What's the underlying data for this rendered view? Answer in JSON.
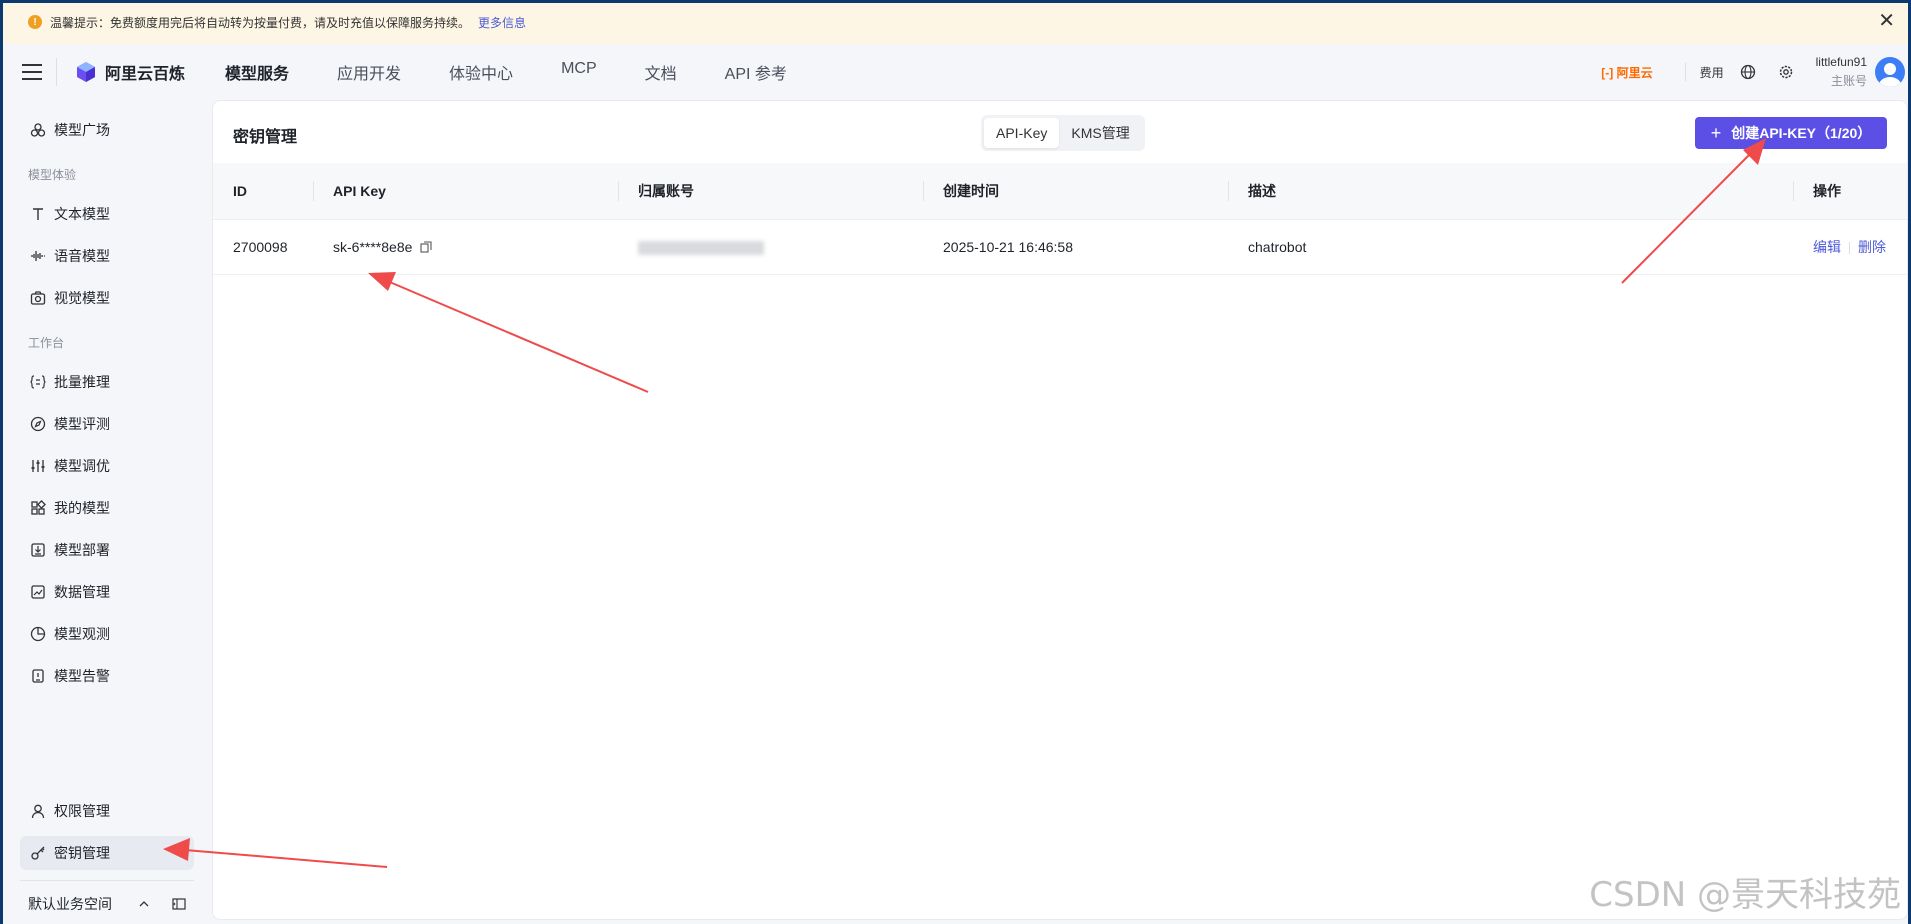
{
  "notice": {
    "text": "温馨提示：免费额度用完后将自动转为按量付费，请及时充值以保障服务持续。",
    "more_link": "更多信息",
    "close": "✕"
  },
  "header": {
    "brand": "阿里云百炼",
    "nav": [
      "模型服务",
      "应用开发",
      "体验中心",
      "MCP",
      "文档",
      "API 参考"
    ],
    "aliyun_label": "[-] 阿里云",
    "fee_label": "费用",
    "username": "littlefun91",
    "role": "主账号"
  },
  "sidebar": {
    "top_item": "模型广场",
    "section_experience": "模型体验",
    "experience_items": [
      "文本模型",
      "语音模型",
      "视觉模型"
    ],
    "section_workbench": "工作台",
    "workbench_items": [
      "批量推理",
      "模型评测",
      "模型调优",
      "我的模型",
      "模型部署",
      "数据管理",
      "模型观测",
      "模型告警"
    ],
    "bottom_items": [
      "权限管理",
      "密钥管理"
    ],
    "workspace": "默认业务空间"
  },
  "main": {
    "title": "密钥管理",
    "tabs": [
      "API-Key",
      "KMS管理"
    ],
    "create_button": "创建API-KEY（1/20）",
    "columns": [
      "ID",
      "API Key",
      "归属账号",
      "创建时间",
      "描述",
      "操作"
    ],
    "rows": [
      {
        "id": "2700098",
        "api_key": "sk-6****8e8e",
        "created": "2025-10-21 16:46:58",
        "desc": "chatrobot",
        "edit": "编辑",
        "delete": "删除"
      }
    ]
  },
  "watermark": "CSDN @景天科技苑",
  "colors": {
    "accent": "#5b4fe6",
    "link": "#4e5bd8",
    "notice_bg": "#fdf6e4",
    "arrow": "#ef4b4b",
    "aliyun_orange": "#ff6a00"
  }
}
